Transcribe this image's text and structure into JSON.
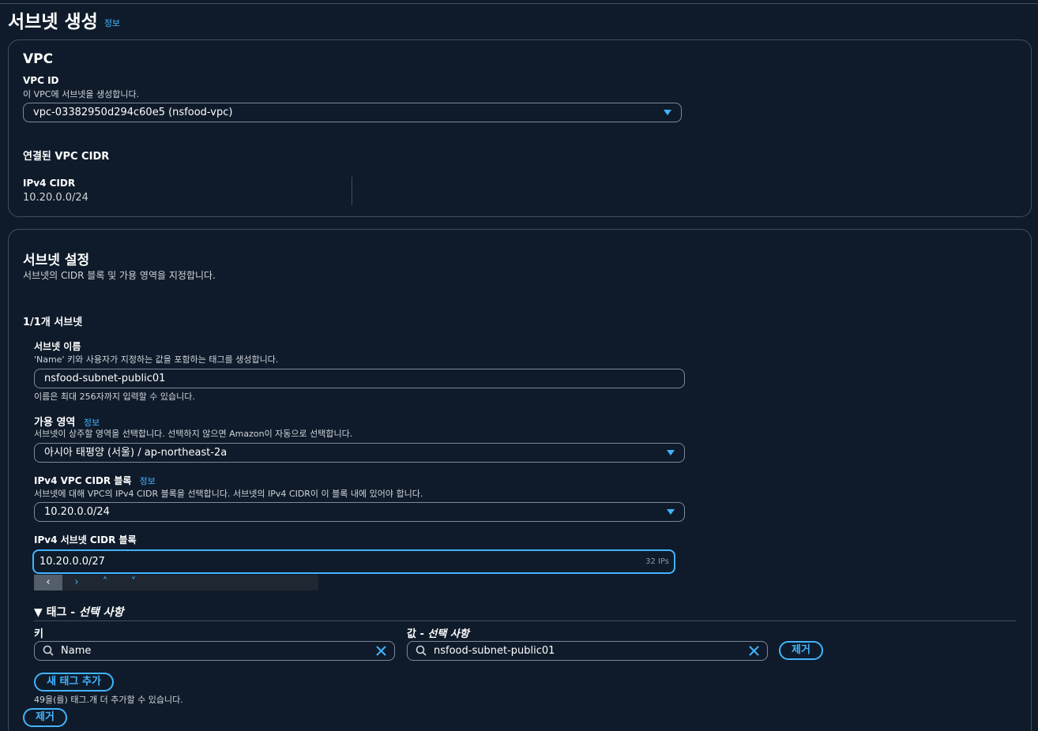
{
  "page": {
    "title": "서브넷 생성",
    "info": "정보"
  },
  "vpc_section": {
    "heading": "VPC",
    "vpc_id_label": "VPC ID",
    "vpc_id_desc": "이 VPC에 서브넷을 생성합니다.",
    "vpc_id_value": "vpc-03382950d294c60e5 (nsfood-vpc)",
    "cidr_heading": "연결된 VPC CIDR",
    "ipv4_cidr_label": "IPv4 CIDR",
    "ipv4_cidr_value": "10.20.0.0/24"
  },
  "subnet_section": {
    "heading": "서브넷 설정",
    "desc": "서브넷의 CIDR 블록 및 가용 영역을 지정합니다.",
    "count_label": "1/1개 서브넷",
    "name": {
      "label": "서브넷 이름",
      "desc": "'Name' 키와 사용자가 지정하는 값을 포함하는 태그를 생성합니다.",
      "value": "nsfood-subnet-public01",
      "hint": "이름은 최대 256자까지 입력할 수 있습니다."
    },
    "az": {
      "label": "가용 영역",
      "info": "정보",
      "desc": "서브넷이 상주할 영역을 선택합니다. 선택하지 않으면 Amazon이 자동으로 선택합니다.",
      "value": "아시아 태평양 (서울) / ap-northeast-2a"
    },
    "vpc_cidr": {
      "label": "IPv4 VPC CIDR 블록",
      "info": "정보",
      "desc": "서브넷에 대해 VPC의 IPv4 CIDR 블록을 선택합니다. 서브넷의 IPv4 CIDR이 이 블록 내에 있어야 합니다.",
      "value": "10.20.0.0/24"
    },
    "subnet_cidr": {
      "label": "IPv4 서브넷 CIDR 블록",
      "value": "10.20.0.0/27",
      "suffix": "32 IPs"
    },
    "nav": {
      "prev": "‹",
      "next": "›",
      "up": "˄",
      "down": "˅"
    },
    "tags": {
      "expander_prefix": "▼ 태그 - ",
      "expander_optional": "선택 사항",
      "key_label": "키",
      "value_label_prefix": "값 - ",
      "value_label_optional": "선택 사항",
      "key_value": "Name",
      "value_value": "nsfood-subnet-public01",
      "remove": "제거",
      "add_button": "새 태그 추가",
      "remaining": "49을(를) 태그.개 더 추가할 수 있습니다."
    },
    "remove_subnet": "제거"
  },
  "colors": {
    "accent": "#42b4ff",
    "background": "#0f1b2a",
    "border": "#414d5c"
  }
}
